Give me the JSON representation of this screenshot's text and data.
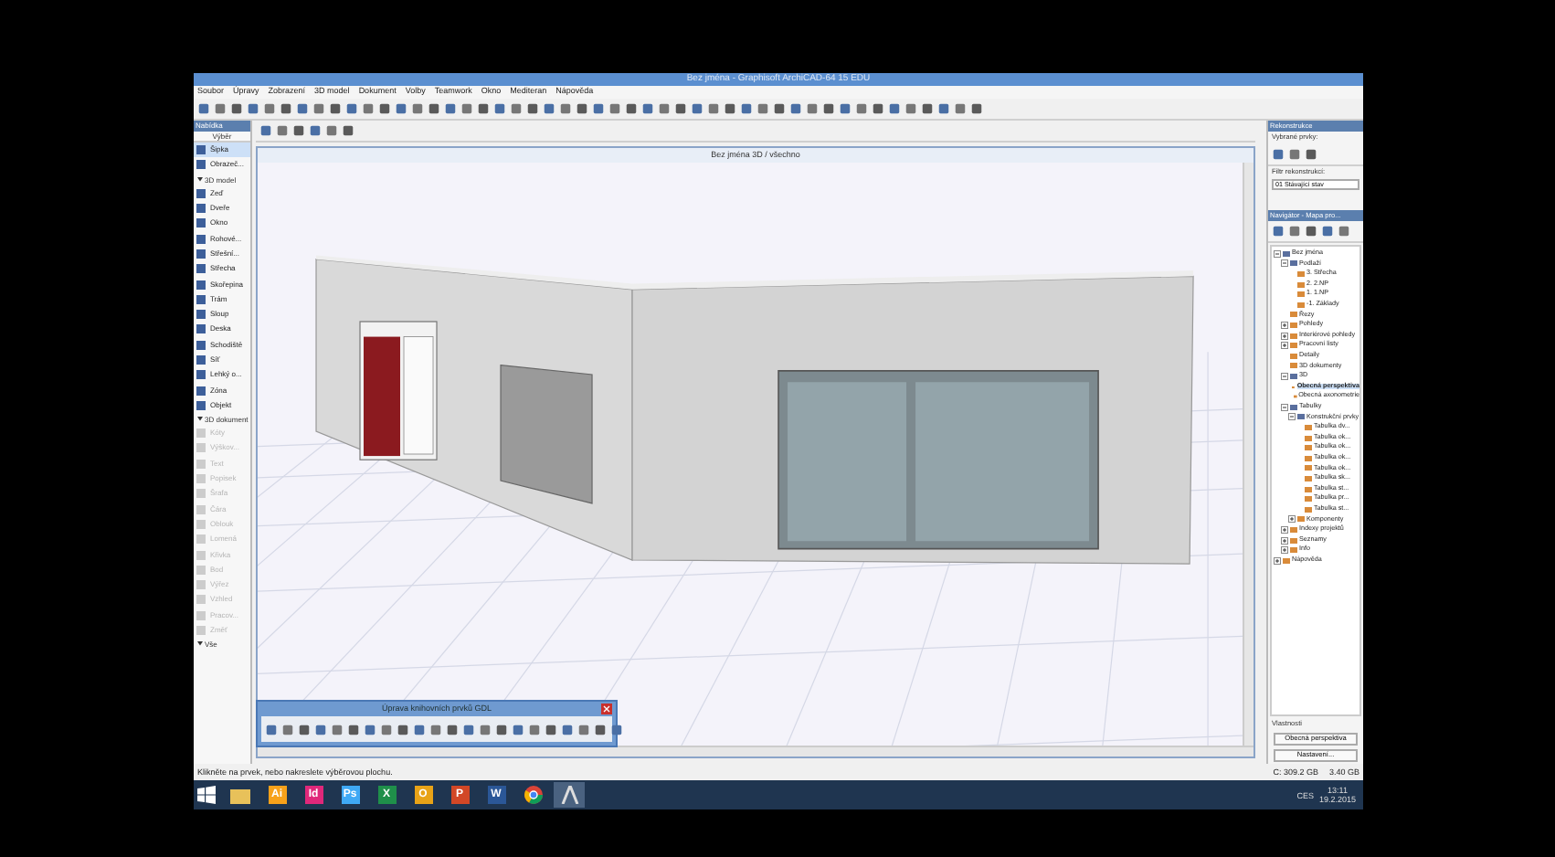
{
  "window": {
    "title": "Bez jména - Graphisoft ArchiCAD-64 15 EDU"
  },
  "menu": [
    "Soubor",
    "Úpravy",
    "Zobrazení",
    "3D model",
    "Dokument",
    "Volby",
    "Teamwork",
    "Okno",
    "Mediteran",
    "Nápověda"
  ],
  "toolbox": {
    "title": "Nabídka",
    "header": "Výběr",
    "items": [
      {
        "kind": "tool",
        "label": "Šipka",
        "selected": true,
        "disabled": false
      },
      {
        "kind": "tool",
        "label": "Obrazeč...",
        "selected": false,
        "disabled": false
      },
      {
        "kind": "section",
        "label": "3D model"
      },
      {
        "kind": "tool",
        "label": "Zeď",
        "selected": false,
        "disabled": false
      },
      {
        "kind": "tool",
        "label": "Dveře",
        "selected": false,
        "disabled": false
      },
      {
        "kind": "tool",
        "label": "Okno",
        "selected": false,
        "disabled": false
      },
      {
        "kind": "tool",
        "label": "Rohové...",
        "selected": false,
        "disabled": false
      },
      {
        "kind": "tool",
        "label": "Střešní...",
        "selected": false,
        "disabled": false
      },
      {
        "kind": "tool",
        "label": "Střecha",
        "selected": false,
        "disabled": false
      },
      {
        "kind": "tool",
        "label": "Skořepina",
        "selected": false,
        "disabled": false
      },
      {
        "kind": "tool",
        "label": "Trám",
        "selected": false,
        "disabled": false
      },
      {
        "kind": "tool",
        "label": "Sloup",
        "selected": false,
        "disabled": false
      },
      {
        "kind": "tool",
        "label": "Deska",
        "selected": false,
        "disabled": false
      },
      {
        "kind": "tool",
        "label": "Schodiště",
        "selected": false,
        "disabled": false
      },
      {
        "kind": "tool",
        "label": "Síť",
        "selected": false,
        "disabled": false
      },
      {
        "kind": "tool",
        "label": "Lehký o...",
        "selected": false,
        "disabled": false
      },
      {
        "kind": "tool",
        "label": "Zóna",
        "selected": false,
        "disabled": false
      },
      {
        "kind": "tool",
        "label": "Objekt",
        "selected": false,
        "disabled": false
      },
      {
        "kind": "section",
        "label": "3D dokument"
      },
      {
        "kind": "tool",
        "label": "Kóty",
        "selected": false,
        "disabled": true
      },
      {
        "kind": "tool",
        "label": "Výškov...",
        "selected": false,
        "disabled": true
      },
      {
        "kind": "tool",
        "label": "Text",
        "selected": false,
        "disabled": true
      },
      {
        "kind": "tool",
        "label": "Popisek",
        "selected": false,
        "disabled": true
      },
      {
        "kind": "tool",
        "label": "Šrafa",
        "selected": false,
        "disabled": true
      },
      {
        "kind": "tool",
        "label": "Čára",
        "selected": false,
        "disabled": true
      },
      {
        "kind": "tool",
        "label": "Oblouk",
        "selected": false,
        "disabled": true
      },
      {
        "kind": "tool",
        "label": "Lomená",
        "selected": false,
        "disabled": true
      },
      {
        "kind": "tool",
        "label": "Křivka",
        "selected": false,
        "disabled": true
      },
      {
        "kind": "tool",
        "label": "Bod",
        "selected": false,
        "disabled": true
      },
      {
        "kind": "tool",
        "label": "Výřez",
        "selected": false,
        "disabled": true
      },
      {
        "kind": "tool",
        "label": "Vzhled",
        "selected": false,
        "disabled": true
      },
      {
        "kind": "tool",
        "label": "Pracov...",
        "selected": false,
        "disabled": true
      },
      {
        "kind": "tool",
        "label": "Změť",
        "selected": false,
        "disabled": true
      },
      {
        "kind": "section",
        "label": "Vše"
      }
    ]
  },
  "view3d": {
    "title": "Bez jména 3D / všechno"
  },
  "gdl_palette": {
    "title": "Úprava knihovních prvků GDL"
  },
  "renovation": {
    "title": "Rekonstrukce",
    "label": "Vybrané prvky:",
    "filter_label": "Filtr rekonstrukcí:",
    "filter_value": "01 Stávající stav"
  },
  "navigator": {
    "title": "Navigátor - Mapa pro...",
    "tree": [
      {
        "label": "Bez jména",
        "expanded": true,
        "selected": false,
        "children": [
          {
            "label": "Podlaží",
            "expanded": true,
            "selected": false,
            "children": [
              {
                "label": "3. Střecha",
                "selected": false
              },
              {
                "label": "2. 2.NP",
                "selected": false
              },
              {
                "label": "1. 1.NP",
                "selected": false
              },
              {
                "label": "-1. Základy",
                "selected": false
              }
            ]
          },
          {
            "label": "Řezy",
            "selected": false
          },
          {
            "label": "Pohledy",
            "expanded": false,
            "selected": false
          },
          {
            "label": "Interiérové pohledy",
            "expanded": false,
            "selected": false
          },
          {
            "label": "Pracovní listy",
            "expanded": false,
            "selected": false
          },
          {
            "label": "Detaily",
            "selected": false
          },
          {
            "label": "3D dokumenty",
            "selected": false
          },
          {
            "label": "3D",
            "expanded": true,
            "selected": false,
            "children": [
              {
                "label": "Obecná perspektiva",
                "selected": true
              },
              {
                "label": "Obecná axonometrie",
                "selected": false
              }
            ]
          },
          {
            "label": "Tabulky",
            "expanded": true,
            "selected": false,
            "children": [
              {
                "label": "Konstrukční prvky",
                "expanded": true,
                "selected": false,
                "children": [
                  {
                    "label": "Tabulka dv...",
                    "selected": false
                  },
                  {
                    "label": "Tabulka ok...",
                    "selected": false
                  },
                  {
                    "label": "Tabulka ok...",
                    "selected": false
                  },
                  {
                    "label": "Tabulka ok...",
                    "selected": false
                  },
                  {
                    "label": "Tabulka ok...",
                    "selected": false
                  },
                  {
                    "label": "Tabulka sk...",
                    "selected": false
                  },
                  {
                    "label": "Tabulka st...",
                    "selected": false
                  },
                  {
                    "label": "Tabulka pr...",
                    "selected": false
                  },
                  {
                    "label": "Tabulka st...",
                    "selected": false
                  }
                ]
              },
              {
                "label": "Komponenty",
                "expanded": false,
                "selected": false
              }
            ]
          },
          {
            "label": "Indexy projektů",
            "expanded": false,
            "selected": false
          },
          {
            "label": "Seznamy",
            "expanded": false,
            "selected": false
          },
          {
            "label": "Info",
            "expanded": false,
            "selected": false
          }
        ]
      },
      {
        "label": "Nápověda",
        "expanded": false,
        "selected": false
      }
    ]
  },
  "properties": {
    "title": "Vlastnosti",
    "view_name": "Obecná perspektiva",
    "settings_button": "Nastavení..."
  },
  "status_bar": {
    "hint": "Klikněte na prvek, nebo nakreslete výběrovou plochu.",
    "disk": "C: 309.2 GB",
    "memory": "3.40 GB"
  },
  "taskbar": {
    "apps": [
      {
        "kind": "folder",
        "selected": false
      },
      {
        "kind": "text",
        "label": "Ai",
        "color": "#f7a11a",
        "selected": false
      },
      {
        "kind": "text",
        "label": "Id",
        "color": "#e0287a",
        "selected": false
      },
      {
        "kind": "text",
        "label": "Ps",
        "color": "#3fa9f5",
        "selected": false
      },
      {
        "kind": "text",
        "label": "X",
        "color": "#1f8f4a",
        "selected": false
      },
      {
        "kind": "text",
        "label": "O",
        "color": "#e8a317",
        "selected": false
      },
      {
        "kind": "text",
        "label": "P",
        "color": "#d24726",
        "selected": false
      },
      {
        "kind": "text",
        "label": "W",
        "color": "#2b5797",
        "selected": false
      },
      {
        "kind": "browser",
        "selected": false
      },
      {
        "kind": "archicad",
        "selected": true
      }
    ],
    "language": "CES",
    "time": "13:11",
    "date": "19.2.2015"
  }
}
